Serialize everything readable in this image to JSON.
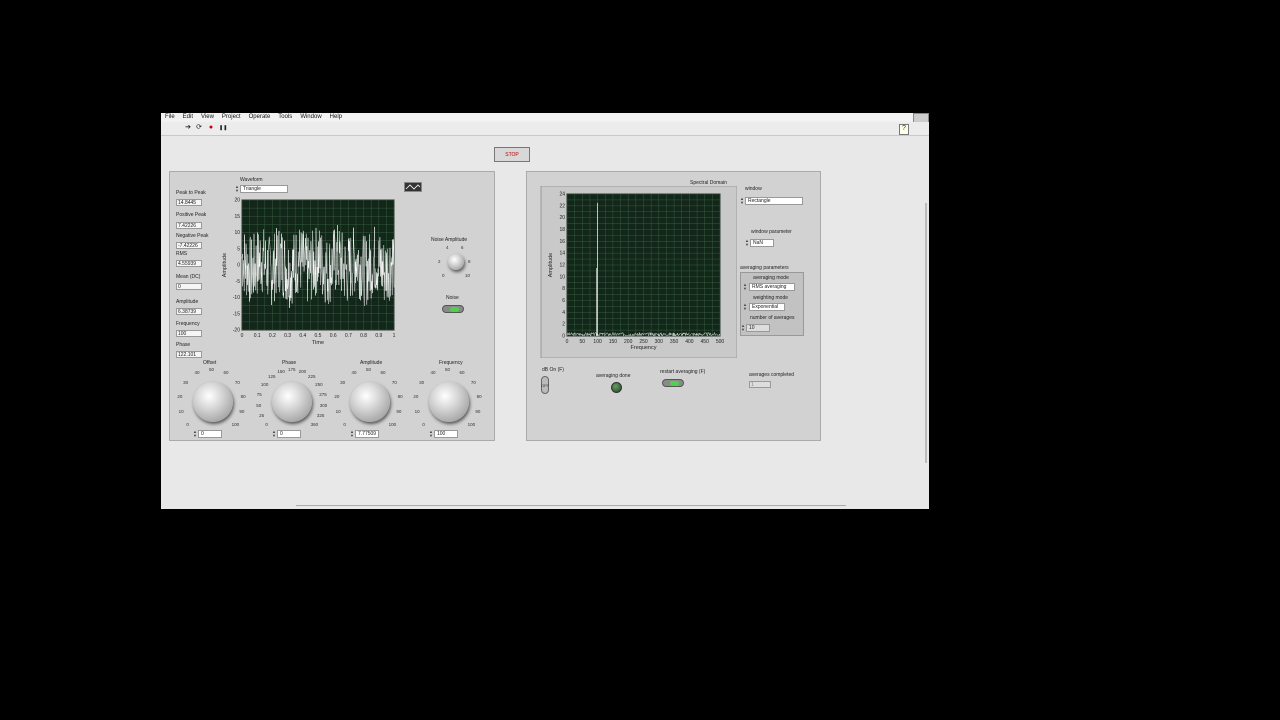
{
  "menu": [
    "File",
    "Edit",
    "View",
    "Project",
    "Operate",
    "Tools",
    "Window",
    "Help"
  ],
  "toolbar": {
    "run": "➔",
    "run_continuous": "⟳",
    "abort": "●",
    "pause": "❚❚",
    "help": "?"
  },
  "stop_label": "STOP",
  "measurements": {
    "peak_to_peak": {
      "label": "Peak to Peak",
      "value": "14.8445"
    },
    "positive_peak": {
      "label": "Positive Peak",
      "value": "7.42226"
    },
    "negative_peak": {
      "label": "Negative Peak",
      "value": "-7.42226"
    },
    "rms": {
      "label": "RMS",
      "value": "4.55939"
    },
    "mean": {
      "label": "Mean (DC)",
      "value": "0"
    },
    "amplitude": {
      "label": "Amplitude",
      "value": "6.38739"
    },
    "frequency": {
      "label": "Frequency",
      "value": "100"
    },
    "phase": {
      "label": "Phase",
      "value": "122.101"
    }
  },
  "waveform": {
    "label": "Waveform",
    "value": "Triangle"
  },
  "time_graph": {
    "xlabel": "Time",
    "ylabel": "Amplitude",
    "xticks": [
      "0",
      "0.1",
      "0.2",
      "0.3",
      "0.4",
      "0.5",
      "0.6",
      "0.7",
      "0.8",
      "0.9",
      "1"
    ],
    "yticks": [
      "20",
      "15",
      "10",
      "5",
      "0",
      "-5",
      "-10",
      "-15",
      "-20"
    ]
  },
  "noise_amplitude": {
    "label": "Noise Amplitude",
    "ticks": [
      "0",
      "2",
      "4",
      "6",
      "8",
      "10"
    ]
  },
  "noise": {
    "label": "Noise",
    "on": true
  },
  "knobs": [
    {
      "label": "Offset",
      "value": "0",
      "ticks": [
        "0",
        "10",
        "20",
        "30",
        "40",
        "50",
        "60",
        "70",
        "80",
        "90",
        "100"
      ]
    },
    {
      "label": "Phase",
      "value": "0",
      "ticks": [
        "0",
        "25",
        "50",
        "75",
        "100",
        "125",
        "150",
        "175",
        "200",
        "225",
        "250",
        "275",
        "300",
        "325",
        "360"
      ]
    },
    {
      "label": "Amplitude",
      "value": "7.77509",
      "ticks": [
        "0",
        "10",
        "20",
        "30",
        "40",
        "50",
        "60",
        "70",
        "80",
        "90",
        "100"
      ]
    },
    {
      "label": "Frequency",
      "value": "100",
      "ticks": [
        "0",
        "10",
        "20",
        "30",
        "40",
        "50",
        "60",
        "70",
        "80",
        "90",
        "100"
      ]
    }
  ],
  "spectral": {
    "title": "Spectral Domain",
    "xlabel": "Frequency",
    "ylabel": "Amplitude",
    "xticks": [
      "0",
      "50",
      "100",
      "150",
      "200",
      "250",
      "300",
      "350",
      "400",
      "450",
      "500"
    ],
    "yticks": [
      "24",
      "22",
      "20",
      "18",
      "16",
      "14",
      "12",
      "10",
      "8",
      "6",
      "4",
      "2",
      "0"
    ]
  },
  "window": {
    "label": "window",
    "value": "Rectangle"
  },
  "window_parameter": {
    "label": "window parameter",
    "value": "NaN"
  },
  "averaging": {
    "title": "averaging parameters",
    "mode_label": "averaging mode",
    "mode_value": "RMS averaging",
    "weighting_label": "weighting mode",
    "weighting_value": "Exponential",
    "count_label": "number of averages",
    "count_value": "10"
  },
  "db_on": {
    "label": "dB On (F)",
    "state": "OFF"
  },
  "averaging_done": {
    "label": "averaging done"
  },
  "restart_averaging": {
    "label": "restart averaging (F)"
  },
  "averages_completed": {
    "label": "averages completed",
    "value": "1"
  },
  "colors": {
    "led_on": "#4fd14f",
    "graph_bg": "#13261a",
    "grid": "#3a6a45",
    "trace": "#ffffff",
    "stop_text": "#bb0000"
  }
}
